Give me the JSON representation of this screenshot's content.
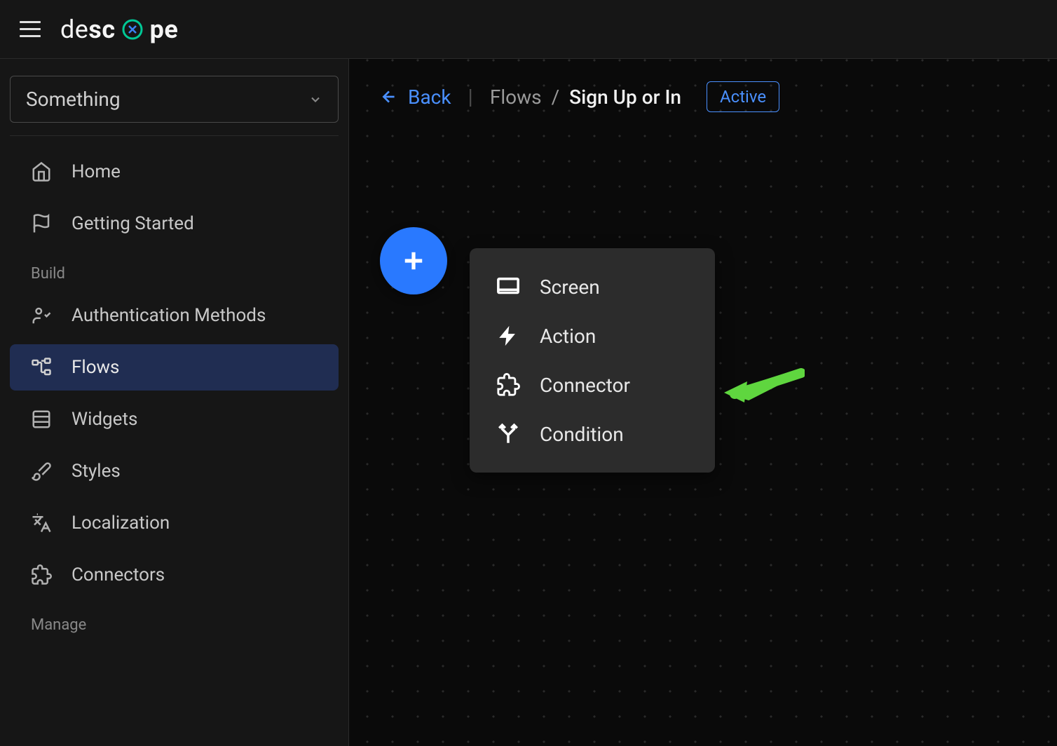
{
  "logo": {
    "prefix": "de",
    "middle": "sc",
    "accent": "o",
    "suffix": "pe"
  },
  "sidebar": {
    "project_name": "Something",
    "items": [
      {
        "label": "Home"
      },
      {
        "label": "Getting Started"
      }
    ],
    "sections": {
      "build": {
        "label": "Build",
        "items": [
          {
            "label": "Authentication Methods"
          },
          {
            "label": "Flows"
          },
          {
            "label": "Widgets"
          },
          {
            "label": "Styles"
          },
          {
            "label": "Localization"
          },
          {
            "label": "Connectors"
          }
        ]
      },
      "manage": {
        "label": "Manage"
      }
    }
  },
  "canvas": {
    "back_label": "Back",
    "breadcrumb_root": "Flows",
    "breadcrumb_current": "Sign Up or In",
    "status": "Active"
  },
  "popup": {
    "items": [
      {
        "label": "Screen"
      },
      {
        "label": "Action"
      },
      {
        "label": "Connector"
      },
      {
        "label": "Condition"
      }
    ]
  }
}
